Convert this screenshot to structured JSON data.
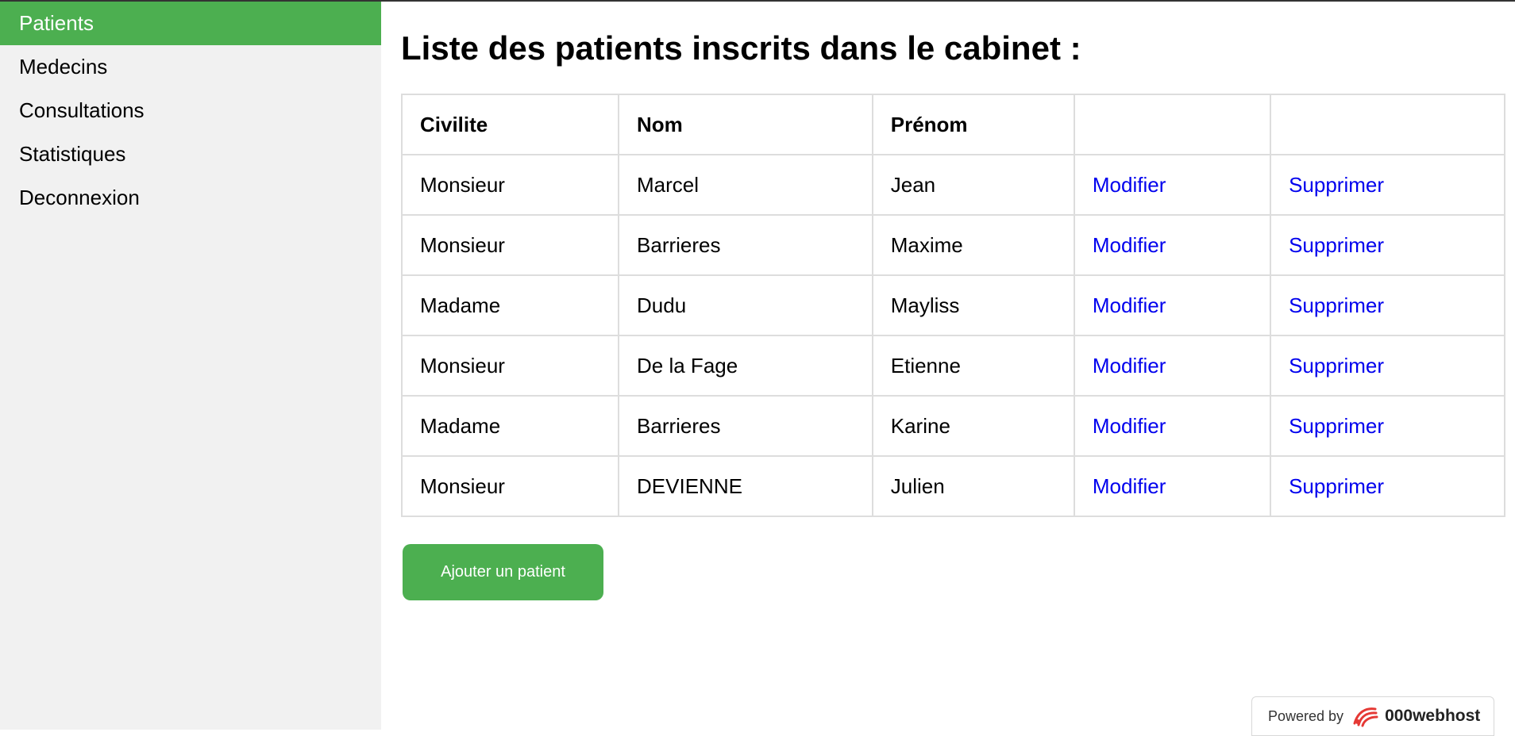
{
  "sidebar": {
    "items": [
      {
        "label": "Patients",
        "active": true
      },
      {
        "label": "Medecins"
      },
      {
        "label": "Consultations"
      },
      {
        "label": "Statistiques"
      },
      {
        "label": "Deconnexion"
      }
    ]
  },
  "main": {
    "title": "Liste des patients inscrits dans le cabinet :",
    "table": {
      "headers": [
        "Civilite",
        "Nom",
        "Prénom",
        "",
        ""
      ],
      "rows": [
        {
          "civilite": "Monsieur",
          "nom": "Marcel",
          "prenom": "Jean",
          "modifier": "Modifier",
          "supprimer": "Supprimer"
        },
        {
          "civilite": "Monsieur",
          "nom": "Barrieres",
          "prenom": "Maxime",
          "modifier": "Modifier",
          "supprimer": "Supprimer"
        },
        {
          "civilite": "Madame",
          "nom": "Dudu",
          "prenom": "Mayliss",
          "modifier": "Modifier",
          "supprimer": "Supprimer"
        },
        {
          "civilite": "Monsieur",
          "nom": "De la Fage",
          "prenom": "Etienne",
          "modifier": "Modifier",
          "supprimer": "Supprimer"
        },
        {
          "civilite": "Madame",
          "nom": "Barrieres",
          "prenom": "Karine",
          "modifier": "Modifier",
          "supprimer": "Supprimer"
        },
        {
          "civilite": "Monsieur",
          "nom": "DEVIENNE",
          "prenom": "Julien",
          "modifier": "Modifier",
          "supprimer": "Supprimer"
        }
      ]
    },
    "add_button_label": "Ajouter un patient"
  },
  "footer_badge": {
    "powered_by": "Powered by",
    "brand": "000webhost",
    "icon": "000webhost-logo-icon"
  },
  "colors": {
    "accent": "#4caf50",
    "sidebar_bg": "#f1f1f1",
    "link": "#0000ee",
    "logo": "#e53935"
  }
}
